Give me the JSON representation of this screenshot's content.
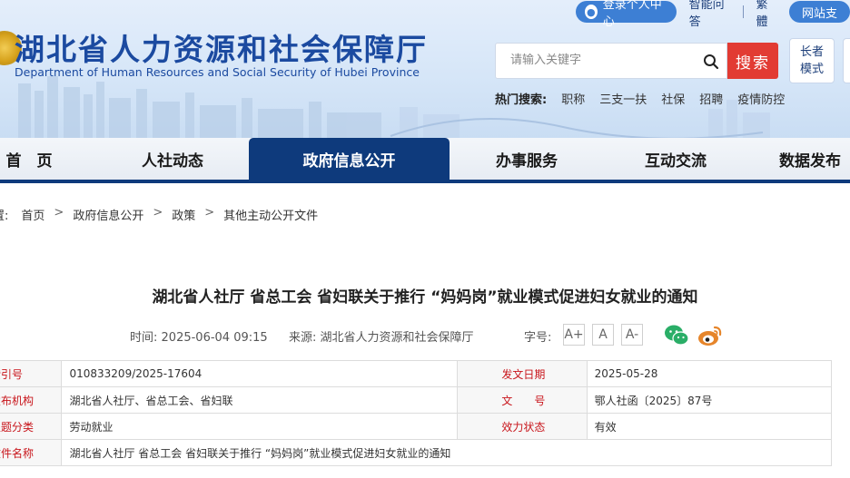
{
  "header": {
    "title": "湖北省人力资源和社会保障厅",
    "subtitle": "Department of Human Resources and Social Security of Hubei Province",
    "topbar": {
      "login": "登录个人中心",
      "qa": "智能问答",
      "traditional": "繁體",
      "site_support": "网站支"
    },
    "search": {
      "placeholder": "请输入关键字",
      "button": "搜索"
    },
    "elder_mode": [
      "长者",
      "模式"
    ],
    "hot_search": {
      "label": "热门搜索:",
      "items": [
        "职称",
        "三支一扶",
        "社保",
        "招聘",
        "疫情防控"
      ]
    }
  },
  "nav": {
    "items": [
      "首　页",
      "人社动态",
      "政府信息公开",
      "办事服务",
      "互动交流",
      "数据发布"
    ],
    "active_index": 2
  },
  "breadcrumb": {
    "prefix": "置:",
    "items": [
      "首页",
      "政府信息公开",
      "政策",
      "其他主动公开文件"
    ],
    "separator": ">"
  },
  "article": {
    "title": "湖北省人社厅 省总工会 省妇联关于推行 “妈妈岗”就业模式促进妇女就业的通知",
    "time_label": "时间:",
    "time": "2025-06-04 09:15",
    "source_label": "来源:",
    "source": "湖北省人力资源和社会保障厅",
    "font_size_label": "字号:",
    "font_buttons": [
      "A+",
      "A",
      "A-"
    ],
    "share": [
      "wechat-icon",
      "weibo-icon"
    ]
  },
  "info_table": {
    "rows": [
      {
        "label": "索引号",
        "value": "010833209/2025-17604",
        "label2": "发文日期",
        "value2": "2025-05-28"
      },
      {
        "label": "发布机构",
        "value": "湖北省人社厅、省总工会、省妇联",
        "label2": "文　　号",
        "value2": "鄂人社函〔2025〕87号"
      },
      {
        "label": "主题分类",
        "value": "劳动就业",
        "label2": "效力状态",
        "value2": "有效"
      },
      {
        "label": "文件名称",
        "value": "湖北省人社厅 省总工会 省妇联关于推行 “妈妈岗”就业模式促进妇女就业的通知"
      }
    ]
  },
  "colors": {
    "brand_blue": "#1b4aa0",
    "nav_active": "#0e3a7c",
    "search_red": "#e23b33",
    "label_red": "#c8151b",
    "wechat_green": "#2aae67",
    "weibo_orange": "#e6852a"
  }
}
